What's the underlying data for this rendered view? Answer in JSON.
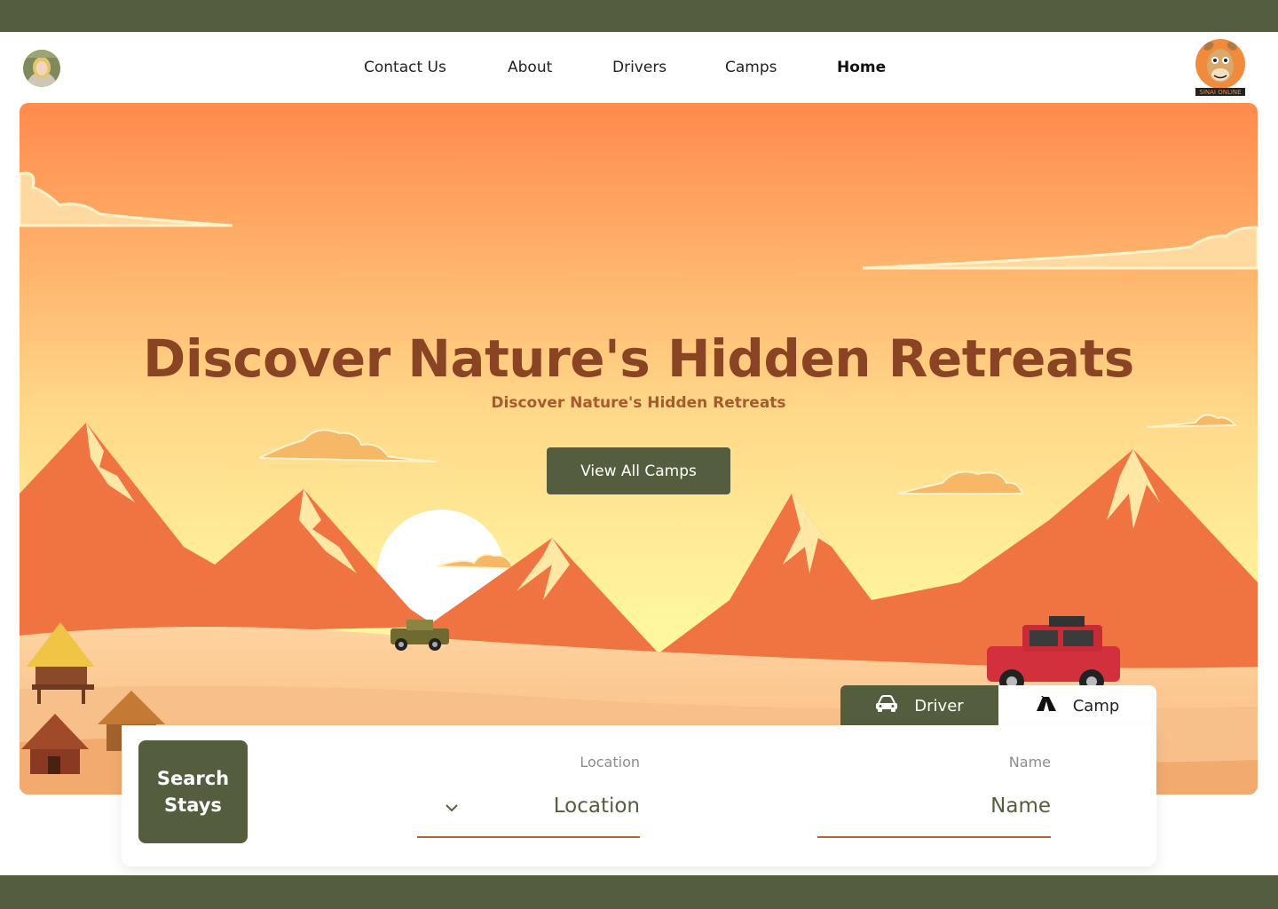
{
  "nav": {
    "links": [
      "Contact Us",
      "About",
      "Drivers",
      "Camps",
      "Home"
    ],
    "active": "Home",
    "logo_text": "SINAI ONLINE"
  },
  "hero": {
    "title": "Discover Nature's Hidden Retreats",
    "subtitle": "Discover Nature's Hidden Retreats",
    "cta_label": "View All Camps"
  },
  "tabs": {
    "driver": {
      "label": "Driver",
      "icon": "car-icon"
    },
    "camp": {
      "label": "Camp",
      "icon": "tent-icon"
    }
  },
  "search": {
    "button_label": "Search Stays",
    "location": {
      "label": "Location",
      "value": "Location",
      "icon": "chevron-down-icon"
    },
    "name": {
      "label": "Name",
      "value": "Name"
    }
  },
  "colors": {
    "brand": "#545e3e",
    "title": "#8a4423",
    "accent_line": "#b5623a"
  }
}
